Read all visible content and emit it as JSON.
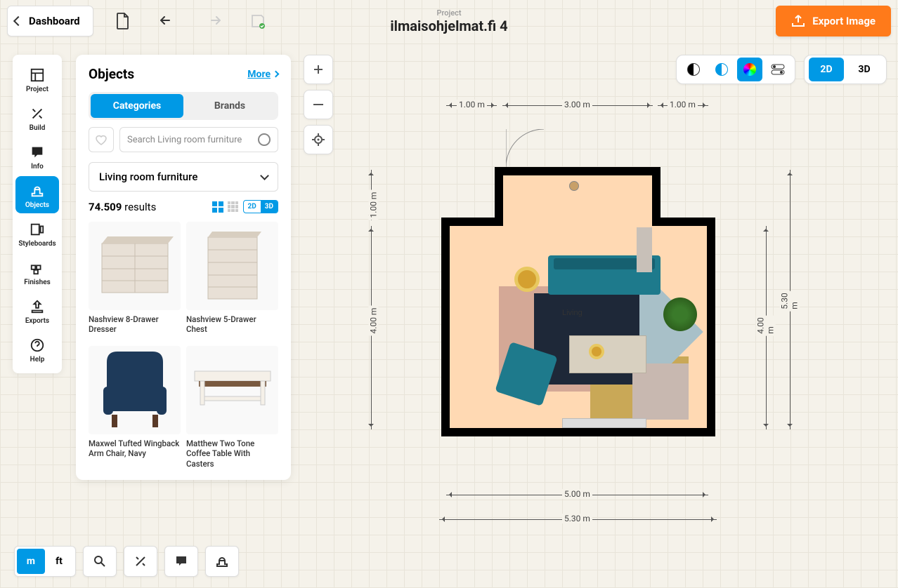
{
  "header": {
    "project_word": "Project",
    "title": "ilmaisohjelmat.fi 4",
    "dashboard": "Dashboard",
    "export": "Export Image"
  },
  "nav": {
    "items": [
      {
        "label": "Project"
      },
      {
        "label": "Build"
      },
      {
        "label": "Info"
      },
      {
        "label": "Objects"
      },
      {
        "label": "Styleboards"
      },
      {
        "label": "Finishes"
      },
      {
        "label": "Exports"
      },
      {
        "label": "Help"
      }
    ]
  },
  "panel": {
    "title": "Objects",
    "more": "More",
    "tabs": {
      "categories": "Categories",
      "brands": "Brands"
    },
    "search_placeholder": "Search Living room furniture",
    "dropdown": "Living room furniture",
    "count_num": "74.509",
    "count_word": "results",
    "view2d": "2D",
    "view3d": "3D",
    "items": [
      {
        "name": "Nashview 8-Drawer Dresser"
      },
      {
        "name": "Nashview 5-Drawer Chest"
      },
      {
        "name": "Maxwel Tufted Wingback Arm Chair, Navy"
      },
      {
        "name": "Matthew Two Tone Coffee Table With Casters"
      }
    ]
  },
  "right": {
    "d2": "2D",
    "d3": "3D"
  },
  "bottom": {
    "m": "m",
    "ft": "ft"
  },
  "plan": {
    "room": "Living",
    "dims": {
      "top1": "1.00 m",
      "top2": "3.00 m",
      "top3": "1.00 m",
      "left1": "1.00 m",
      "left2": "4.00 m",
      "right1": "4.00 m",
      "right2": "5.30 m",
      "bot1": "5.00 m",
      "bot2": "5.30 m"
    }
  }
}
